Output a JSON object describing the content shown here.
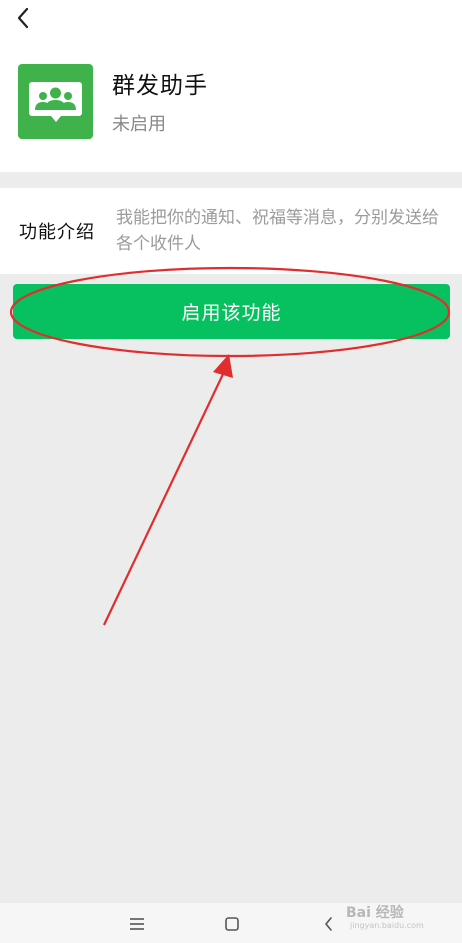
{
  "header": {
    "back_icon": "chevron-left-icon"
  },
  "app": {
    "name": "群发助手",
    "status": "未启用",
    "icon": "group-chat-icon",
    "icon_color": "#3fb24b"
  },
  "intro": {
    "label": "功能介绍",
    "text": "我能把你的通知、祝福等消息，分别发送给各个收件人"
  },
  "actions": {
    "enable_label": "启用该功能",
    "accent_color": "#07c160"
  },
  "annotation": {
    "color": "#e02d2d",
    "shapes": [
      "ellipse-around-enable-button",
      "arrow-pointing-to-enable-button"
    ]
  },
  "navbar": {
    "items": [
      "menu-icon",
      "home-square-icon",
      "back-chevron-icon"
    ]
  },
  "watermark": {
    "brand": "Bai 经验",
    "url": "jingyan.baidu.com"
  }
}
